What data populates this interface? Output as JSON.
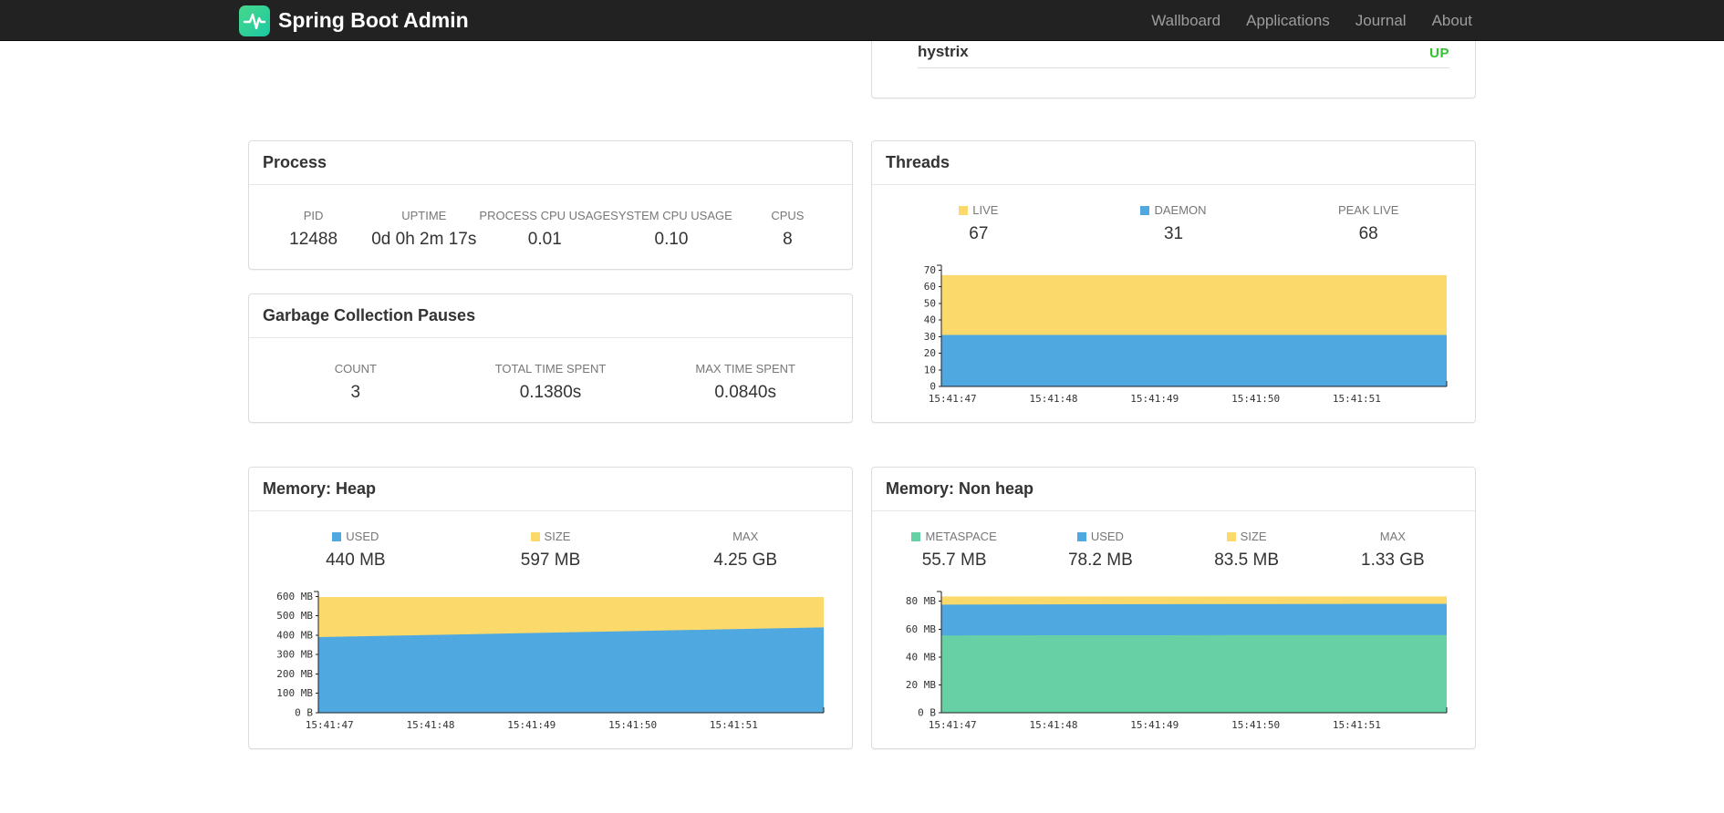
{
  "colors": {
    "yellow": "#fbda6b",
    "blue": "#4fa9e0",
    "green": "#66d1a4",
    "up": "#30c330",
    "axis": "#222222"
  },
  "navbar": {
    "brand": "Spring Boot Admin",
    "items": [
      {
        "label": "Wallboard"
      },
      {
        "label": "Applications"
      },
      {
        "label": "Journal"
      },
      {
        "label": "About"
      }
    ]
  },
  "health": {
    "application": "hystrix",
    "status": "UP"
  },
  "panels": {
    "process": {
      "title": "Process",
      "metrics": [
        {
          "label": "PID",
          "value": "12488"
        },
        {
          "label": "UPTIME",
          "value": "0d 0h 2m 17s"
        },
        {
          "label": "PROCESS CPU USAGE",
          "value": "0.01"
        },
        {
          "label": "SYSTEM CPU USAGE",
          "value": "0.10"
        },
        {
          "label": "CPUS",
          "value": "8"
        }
      ]
    },
    "gc": {
      "title": "Garbage Collection Pauses",
      "metrics": [
        {
          "label": "COUNT",
          "value": "3"
        },
        {
          "label": "TOTAL TIME SPENT",
          "value": "0.1380s"
        },
        {
          "label": "MAX TIME SPENT",
          "value": "0.0840s"
        }
      ]
    },
    "threads": {
      "title": "Threads",
      "metrics": [
        {
          "label": "LIVE",
          "value": "67",
          "swatch": "yellow"
        },
        {
          "label": "DAEMON",
          "value": "31",
          "swatch": "blue"
        },
        {
          "label": "PEAK LIVE",
          "value": "68"
        }
      ]
    },
    "memory_heap": {
      "title": "Memory: Heap",
      "metrics": [
        {
          "label": "USED",
          "value": "440 MB",
          "swatch": "blue"
        },
        {
          "label": "SIZE",
          "value": "597 MB",
          "swatch": "yellow"
        },
        {
          "label": "MAX",
          "value": "4.25 GB"
        }
      ]
    },
    "memory_non_heap": {
      "title": "Memory: Non heap",
      "metrics": [
        {
          "label": "METASPACE",
          "value": "55.7 MB",
          "swatch": "green"
        },
        {
          "label": "USED",
          "value": "78.2 MB",
          "swatch": "blue"
        },
        {
          "label": "SIZE",
          "value": "83.5 MB",
          "swatch": "yellow"
        },
        {
          "label": "MAX",
          "value": "1.33 GB"
        }
      ]
    }
  },
  "chart_data": [
    {
      "id": "threads",
      "type": "area",
      "title": "Threads",
      "xlabel": "",
      "ylabel": "",
      "ylim": [
        0,
        73
      ],
      "yticks": [
        0,
        10,
        20,
        30,
        40,
        50,
        60,
        70
      ],
      "ytick_labels": [
        "0",
        "10",
        "20",
        "30",
        "40",
        "50",
        "60",
        "70"
      ],
      "xticks": [
        "15:41:47",
        "15:41:48",
        "15:41:49",
        "15:41:50",
        "15:41:51"
      ],
      "layout": {
        "label_width": 50,
        "grid": false,
        "legend": "top"
      },
      "series": [
        {
          "name": "LIVE",
          "color": "#fbda6b",
          "values": [
            67,
            67,
            67,
            67,
            67,
            67
          ]
        },
        {
          "name": "DAEMON",
          "color": "#4fa9e0",
          "values": [
            31,
            31,
            31,
            31,
            31,
            31
          ]
        }
      ]
    },
    {
      "id": "heap",
      "type": "area",
      "title": "Memory: Heap (MB)",
      "xlabel": "",
      "ylabel": "",
      "ylim": [
        0,
        625
      ],
      "yticks": [
        0,
        100,
        200,
        300,
        400,
        500,
        600
      ],
      "ytick_labels": [
        "0 B",
        "100 MB",
        "200 MB",
        "300 MB",
        "400 MB",
        "500 MB",
        "600 MB"
      ],
      "xticks": [
        "15:41:47",
        "15:41:48",
        "15:41:49",
        "15:41:50",
        "15:41:51"
      ],
      "layout": {
        "label_width": 50,
        "grid": false,
        "legend": "top"
      },
      "series": [
        {
          "name": "SIZE",
          "color": "#fbda6b",
          "values": [
            597,
            597,
            597,
            597,
            597,
            597
          ]
        },
        {
          "name": "USED",
          "color": "#4fa9e0",
          "values": [
            390,
            400,
            410,
            420,
            430,
            440
          ]
        }
      ]
    },
    {
      "id": "nonheap",
      "type": "area",
      "title": "Memory: Non heap (MB)",
      "xlabel": "",
      "ylabel": "",
      "ylim": [
        0,
        87
      ],
      "yticks": [
        0,
        20,
        40,
        60,
        80
      ],
      "ytick_labels": [
        "0 B",
        "20 MB",
        "40 MB",
        "60 MB",
        "80 MB"
      ],
      "xticks": [
        "15:41:47",
        "15:41:48",
        "15:41:49",
        "15:41:50",
        "15:41:51"
      ],
      "layout": {
        "label_width": 50,
        "grid": false,
        "legend": "top"
      },
      "series": [
        {
          "name": "SIZE",
          "color": "#fbda6b",
          "values": [
            83.5,
            83.5,
            83.5,
            83.5,
            83.5,
            83.5
          ]
        },
        {
          "name": "USED",
          "color": "#4fa9e0",
          "values": [
            77.6,
            77.8,
            77.9,
            78.0,
            78.1,
            78.2
          ]
        },
        {
          "name": "METASPACE",
          "color": "#66d1a4",
          "values": [
            55.5,
            55.6,
            55.6,
            55.7,
            55.7,
            55.7
          ]
        }
      ]
    }
  ]
}
